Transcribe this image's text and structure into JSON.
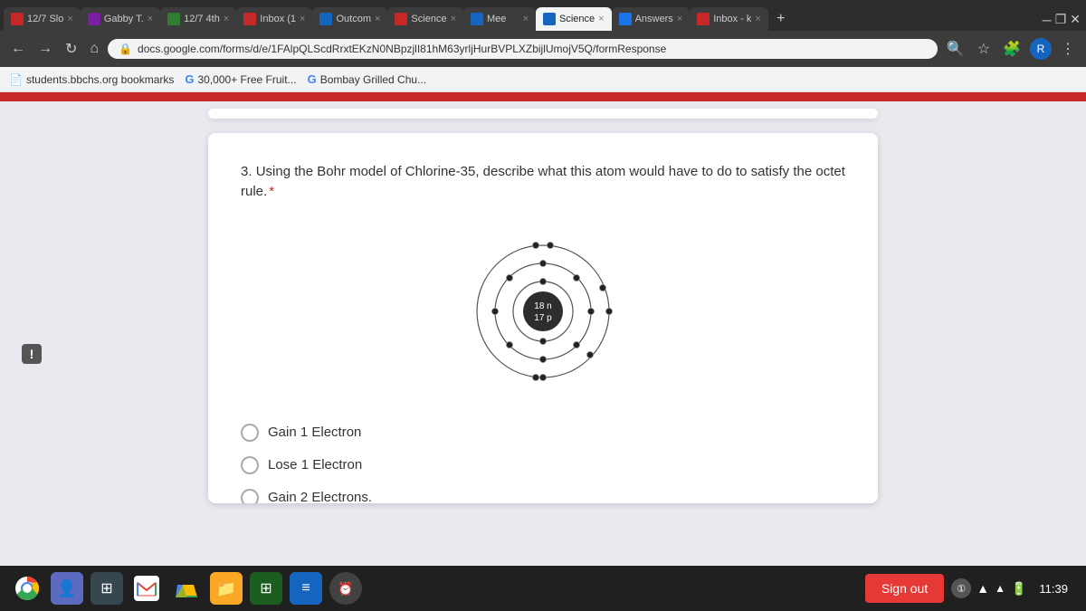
{
  "browser": {
    "tabs": [
      {
        "id": "tab1",
        "label": "12/7 Slo",
        "favicon_color": "#c62828",
        "active": false
      },
      {
        "id": "tab2",
        "label": "Gabby T.",
        "favicon_color": "#7b1fa2",
        "active": false
      },
      {
        "id": "tab3",
        "label": "12/7 4th",
        "favicon_color": "#2e7d32",
        "active": false
      },
      {
        "id": "tab4",
        "label": "Inbox (1",
        "favicon_color": "#c62828",
        "active": false
      },
      {
        "id": "tab5",
        "label": "Outcom",
        "favicon_color": "#1565c0",
        "active": false
      },
      {
        "id": "tab6",
        "label": "Science",
        "favicon_color": "#c62828",
        "active": false
      },
      {
        "id": "tab7",
        "label": "Mee",
        "favicon_color": "#1565c0",
        "active": false
      },
      {
        "id": "tab8",
        "label": "Science",
        "favicon_color": "#1565c0",
        "active": true
      },
      {
        "id": "tab9",
        "label": "Answers",
        "favicon_color": "#1a73e8",
        "active": false
      },
      {
        "id": "tab10",
        "label": "Inbox - k",
        "favicon_color": "#c62828",
        "active": false
      }
    ],
    "address": "docs.google.com/forms/d/e/1FAlpQLScdRrxtEKzN0NBpzjlI81hM63yrljHurBVPLXZbijlUmojV5Q/formResponse",
    "bookmarks": [
      {
        "label": "students.bbchs.org bookmarks"
      },
      {
        "label": "30,000+ Free Fruit..."
      },
      {
        "label": "Bombay Grilled Chu..."
      }
    ]
  },
  "question": {
    "number": "3",
    "text": "Using the Bohr model of Chlorine-35, describe what this atom would have to do to satisfy the octet rule.",
    "required": true,
    "bohr_model": {
      "nucleus_label_top": "18 n",
      "nucleus_label_bottom": "17 p"
    },
    "options": [
      {
        "id": "opt1",
        "label": "Gain 1 Electron"
      },
      {
        "id": "opt2",
        "label": "Lose 1 Electron"
      },
      {
        "id": "opt3",
        "label": "Gain 2 Electrons."
      }
    ]
  },
  "taskbar": {
    "sign_out_label": "Sign out",
    "time": "11:39",
    "circle_btn_label": "①"
  }
}
